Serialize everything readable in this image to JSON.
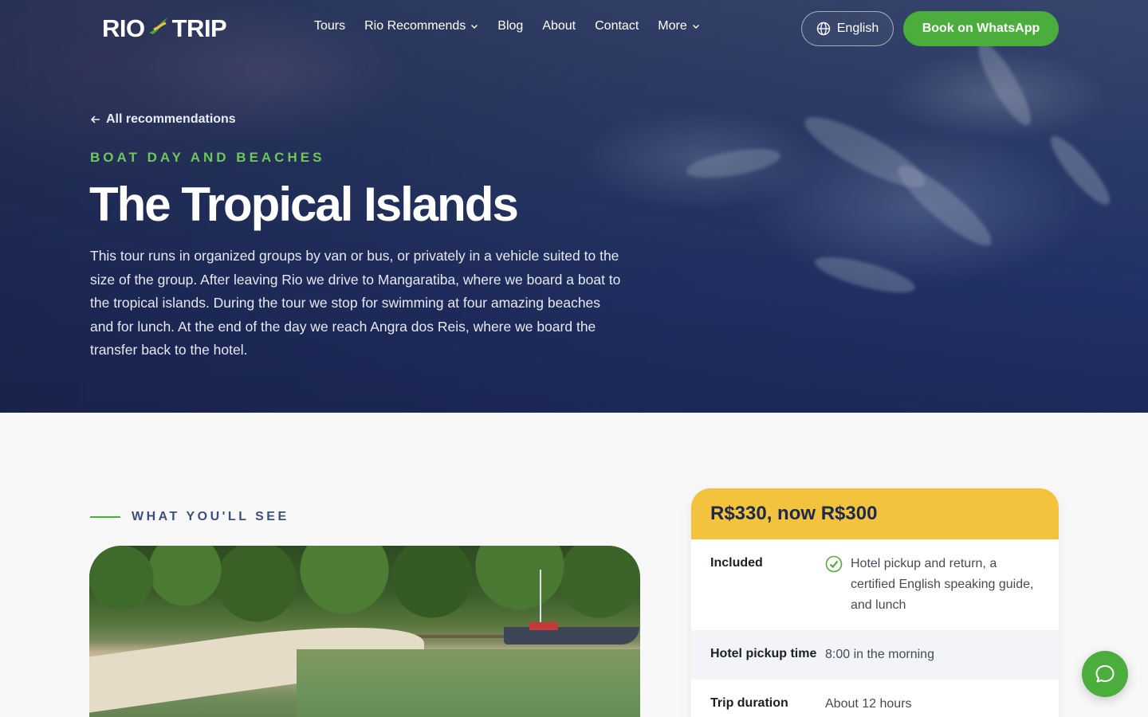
{
  "brand": {
    "logo_left": "RIO",
    "logo_right": "TRIP",
    "accent_green": "#4bad3c",
    "accent_yellow": "#f3c33e"
  },
  "nav": {
    "links": [
      {
        "label": "Tours",
        "has_dropdown": false
      },
      {
        "label": "Rio Recommends",
        "has_dropdown": true
      },
      {
        "label": "Blog",
        "has_dropdown": false
      },
      {
        "label": "About",
        "has_dropdown": false
      },
      {
        "label": "Contact",
        "has_dropdown": false
      },
      {
        "label": "More",
        "has_dropdown": true
      }
    ],
    "language_label": "English",
    "cta_label": "Book on WhatsApp"
  },
  "hero": {
    "back_link": "All recommendations",
    "eyebrow": "BOAT DAY AND BEACHES",
    "title": "The Tropical Islands",
    "description": "This tour runs in organized groups by van or bus, or privately in a vehicle suited to the size of the group. After leaving Rio we drive to Mangaratiba, where we board a boat to the tropical islands. During the tour we stop for swimming at four amazing beaches and for lunch. At the end of the day we reach Angra dos Reis, where we board the transfer back to the hotel."
  },
  "section": {
    "label": "WHAT YOU'LL SEE"
  },
  "price_card": {
    "headline": "R$330, now R$300",
    "rows": [
      {
        "label": "Included",
        "value": "Hotel pickup and return, a certified English speaking guide, and lunch",
        "checked": true
      },
      {
        "label": "Hotel pickup time",
        "value": "8:00 in the morning",
        "checked": false
      },
      {
        "label": "Trip duration",
        "value": "About 12 hours",
        "checked": false
      }
    ]
  },
  "icons": {
    "back": "arrow-left-icon",
    "globe": "globe-icon",
    "chevron": "chevron-down-icon",
    "check": "check-circle-icon",
    "chat": "chat-bubble-icon"
  }
}
